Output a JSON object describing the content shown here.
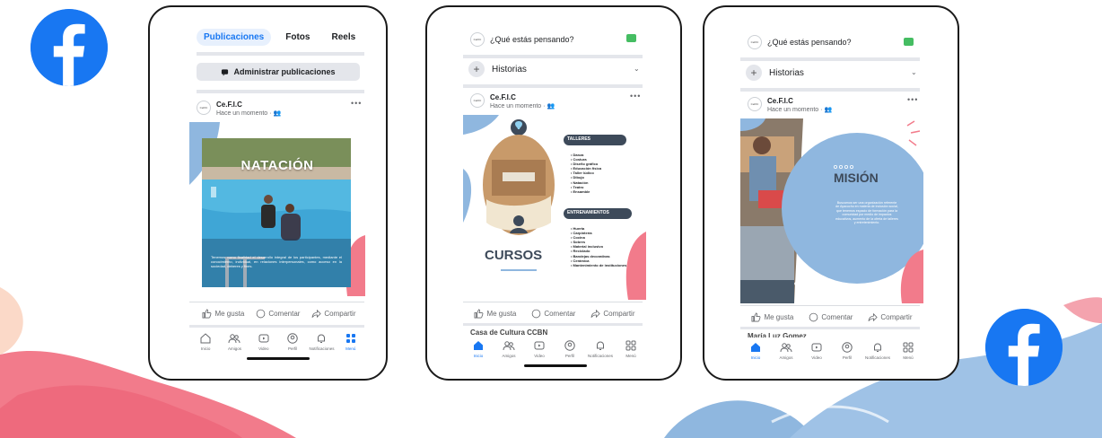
{
  "colors": {
    "brand": "#1877f2",
    "coral": "#f27b8b",
    "sky": "#8fb7df",
    "slate": "#3d4a5a"
  },
  "phone1": {
    "tabs": [
      "Publicaciones",
      "Fotos",
      "Reels"
    ],
    "admin_label": "Administrar publicaciones",
    "post": {
      "author": "Ce.F.I.C",
      "meta": "Hace un momento ·"
    },
    "poster": {
      "title": "NATACIÓN",
      "body": "Tenemos como finalidad el desarrollo integral de los participantes, mediante el conocimiento, individual, en relaciones interpersonales, como acceso en la sociedad, deberes y fines."
    },
    "actions": [
      "Me gusta",
      "Comentar",
      "Compartir"
    ],
    "nav": [
      "Inicio",
      "Amigos",
      "Video",
      "Perfil",
      "Notificaciones",
      "Menú"
    ]
  },
  "phone2": {
    "composer": "¿Qué estás pensando?",
    "historias": "Historias",
    "post": {
      "author": "Ce.F.I.C",
      "meta": "Hace un momento ·"
    },
    "poster": {
      "title": "CURSOS",
      "talleres_label": "TALLERES",
      "talleres": [
        "Danza",
        "Costura",
        "Diseño gráfico",
        "Educación física",
        "Taller lúdico",
        "Dibujo",
        "Natación",
        "Teatro",
        "Ensamble"
      ],
      "entrenamientos_label": "ENTRENAMIENTOS",
      "entrenamientos": [
        "Huerta",
        "Carpintería",
        "Cocina",
        "Sobres",
        "Material inclusivo",
        "Reciclado",
        "Bandejas decorativas",
        "Cerámica",
        "Mantenimiento de instituciones"
      ]
    },
    "actions": [
      "Me gusta",
      "Comentar",
      "Compartir"
    ],
    "next_post_author": "Casa de Cultura CCBN",
    "nav": [
      "Inicio",
      "Amigos",
      "Video",
      "Perfil",
      "Notificaciones",
      "Menú"
    ]
  },
  "phone3": {
    "composer": "¿Qué estás pensando?",
    "historias": "Historias",
    "post": {
      "author": "Ce.F.I.C",
      "meta": "Hace un momento ·"
    },
    "poster": {
      "title": "MISIÓN",
      "body": "Buscamos ser una organización referente de Ayacucho en materia de inclusión social, que tenemos espacio de formación para la comunidad por medio de impactos educativos, aumento de la oferta de talleres y entretenimiento."
    },
    "actions": [
      "Me gusta",
      "Comentar",
      "Compartir"
    ],
    "next_post_author": "María Luz Gomez",
    "nav": [
      "Inicio",
      "Amigos",
      "Video",
      "Perfil",
      "Notificaciones",
      "Menú"
    ]
  }
}
